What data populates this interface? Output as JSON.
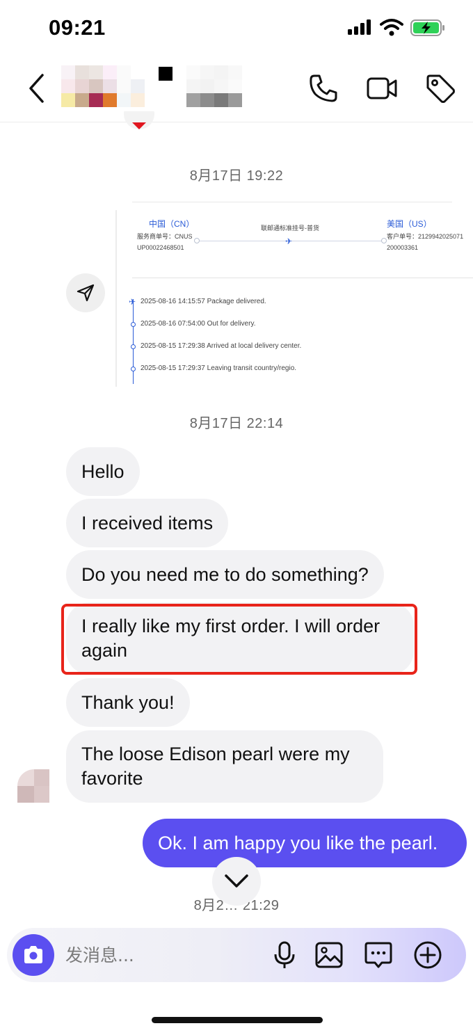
{
  "status_bar": {
    "time": "09:21",
    "icons": [
      "cellular-signal-icon",
      "wifi-icon",
      "battery-charging-icon"
    ]
  },
  "header": {
    "icons": [
      "back-arrow-icon",
      "phone-icon",
      "video-camera-icon",
      "tag-icon"
    ]
  },
  "timestamps": [
    "8月17日 19:22",
    "8月17日 22:14",
    "8月2… 21:29"
  ],
  "tracking_card": {
    "origin_country": "中国（CN）",
    "dest_country": "美国（US）",
    "service": "联邮通标准挂号-普货",
    "origin_label": "服务商单号：CNUS",
    "origin_number": "UP00022468501",
    "dest_label": "客户单号：2129942025071",
    "dest_number": "200003361",
    "events": [
      "2025-08-16 14:15:57  Package delivered.",
      "2025-08-16 07:54:00  Out for delivery.",
      "2025-08-15 17:29:38  Arrived at local delivery center.",
      "2025-08-15 17:29:37  Leaving transit country/regio."
    ]
  },
  "messages": {
    "received": [
      "Hello",
      "I received items",
      "Do you need me to do something?",
      "I really like my first order. I will order again",
      "Thank you!",
      "The loose Edison pearl were my favorite"
    ],
    "sent": [
      "Ok. I am happy you like the pearl."
    ]
  },
  "input": {
    "placeholder": "发消息..."
  },
  "colors": {
    "accent": "#5b4ff0",
    "bubble_gray": "#f2f2f4",
    "highlight_red": "#e8241a",
    "tracking_blue": "#2a5bd7"
  }
}
